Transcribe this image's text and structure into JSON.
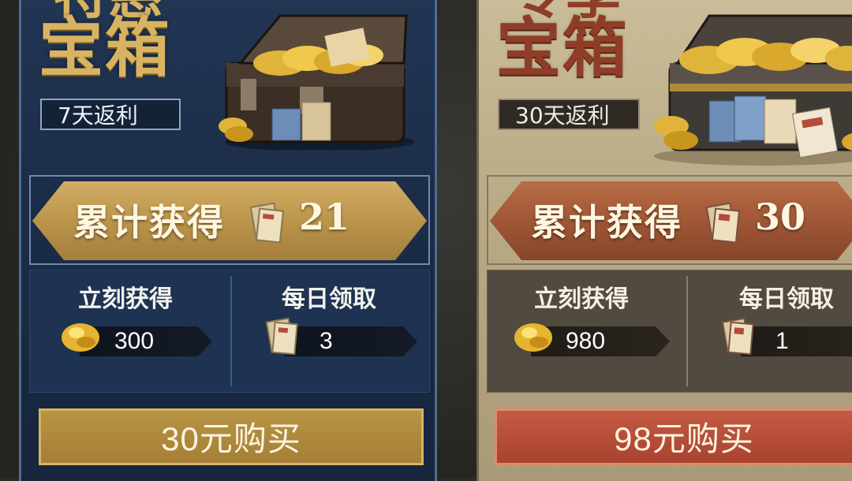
{
  "offers": [
    {
      "theme": "blue",
      "title_top": "特惠",
      "title": "宝箱",
      "rebate": "7天返利",
      "total_label": "累计获得",
      "total_count": "21",
      "instant_label": "立刻获得",
      "instant_value": "300",
      "daily_label": "每日领取",
      "daily_value": "3",
      "buy_label": "30元购买",
      "colors": {
        "accent": "#d8b462",
        "banner": "#b9924a",
        "button": "#a57f35"
      }
    },
    {
      "theme": "tan",
      "title_top": "专享",
      "title": "宝箱",
      "rebate": "30天返利",
      "total_label": "累计获得",
      "total_count": "30",
      "instant_label": "立刻获得",
      "instant_value": "980",
      "daily_label": "每日领取",
      "daily_value": "1",
      "buy_label": "98元购买",
      "colors": {
        "accent": "#8f3d27",
        "banner": "#9d5535",
        "button": "#a8432f"
      }
    }
  ],
  "icons": {
    "chest": "treasure-chest-icon",
    "gold": "gold-nugget-icon",
    "document": "document-ticket-icon"
  }
}
